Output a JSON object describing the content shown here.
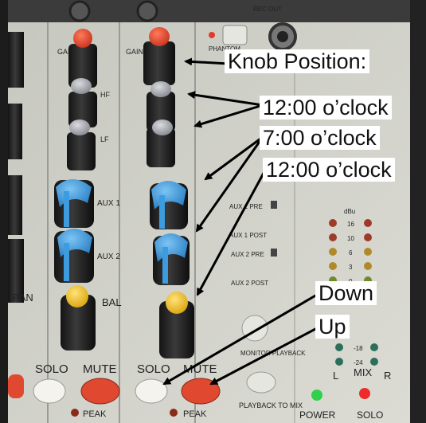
{
  "annotations": {
    "knob_position_title": "Knob Position:",
    "label_1": "12:00 o’clock",
    "label_2": "7:00 o’clock",
    "label_3": "12:00 o’clock",
    "label_down": "Down",
    "label_up": "Up"
  },
  "panel": {
    "gain_label": "GAIN",
    "hf_label": "HF",
    "lf_label": "LF",
    "aux1_label": "AUX 1",
    "aux2_label": "AUX 2",
    "bal_label": "BAL",
    "pan_label": "PAN",
    "solo_label": "SOLO",
    "mute_label": "MUTE",
    "peak_label": "PEAK",
    "phantom_label": "PHANTOM",
    "rec_out_label": "REC OUT",
    "aux1_pre": "AUX 1 PRE",
    "aux1_post": "AUX 1 POST",
    "aux2_pre": "AUX 2 PRE",
    "aux2_post": "AUX 2 POST",
    "monitor_playback": "MONITOR PLAYBACK",
    "playback_to_mix": "PLAYBACK TO MIX",
    "power_label": "POWER",
    "solo_master_label": "SOLO",
    "mix_label": "MIX",
    "l_label": "L",
    "r_label": "R",
    "db_label": "dBu",
    "meter_values": [
      "16",
      "10",
      "6",
      "3",
      "0"
    ],
    "meter_low": [
      "-18",
      "-24"
    ],
    "colors": {
      "panel": "#cfd0c8",
      "knob_body": "#2b2b2b",
      "cap_red": "#e2412c",
      "cap_gray": "#a7a9ad",
      "cap_blue": "#3d9be0",
      "cap_yellow": "#f4c21e",
      "mute_button": "#e0492f",
      "solo_button": "#f4f3ee",
      "led_green": "#2fd14a",
      "led_red": "#ee2b2b"
    }
  }
}
